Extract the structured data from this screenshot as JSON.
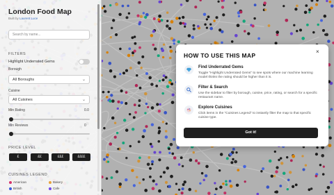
{
  "sidebar": {
    "title": "London Food Map",
    "built_by_prefix": "Built by",
    "built_by_author": "Laurent Luce",
    "search_placeholder": "Search by name...",
    "filters_heading": "FILTERS",
    "highlight_label": "Highlight Underrated Gems",
    "borough_label": "Borough",
    "borough_value": "All Boroughs",
    "cuisine_label": "Cuisine",
    "cuisine_value": "All Cuisines",
    "min_rating_label": "Min Rating",
    "min_rating_value": "0.0",
    "min_reviews_label": "Min Reviews",
    "min_reviews_value": "0",
    "price_heading": "PRICE LEVEL",
    "price_levels": [
      "£",
      "££",
      "£££",
      "££££"
    ],
    "cuisines_legend_heading": "CUISINES LEGEND",
    "legend": [
      {
        "label": "American",
        "color": "#d6336c"
      },
      {
        "label": "Bakery",
        "color": "#e8a33d"
      },
      {
        "label": "British",
        "color": "#3b5bdb"
      },
      {
        "label": "Cafe",
        "color": "#7048e8"
      }
    ]
  },
  "modal": {
    "title": "HOW TO USE THIS MAP",
    "close_glyph": "×",
    "features": [
      {
        "icon": "gem-icon",
        "title": "Find Underrated Gems",
        "desc": "Toggle \"Highlight Underrated Gems\" to see spots where our machine learning model thinks the rating should be higher than it is."
      },
      {
        "icon": "magnifier-icon",
        "title": "Filter & Search",
        "desc": "Use the sidebar to filter by borough, cuisine, price, rating, or search for a specific restaurant name."
      },
      {
        "icon": "palette-icon",
        "title": "Explore Cuisines",
        "desc": "Click items in the \"Cuisines Legend\" to instantly filter the map to that specific cuisine type."
      }
    ],
    "button_label": "Got it!"
  },
  "colors": {
    "map_base": "#c4c4c4",
    "marker_dark": "#1c1c1c",
    "accent_dark": "#1e1e1e"
  }
}
